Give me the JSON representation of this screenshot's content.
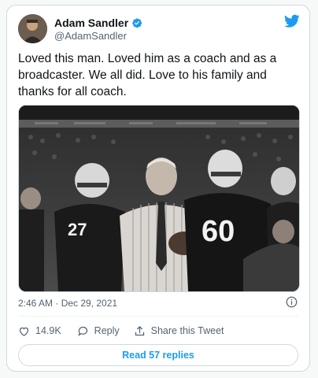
{
  "author": {
    "name": "Adam Sandler",
    "handle": "@AdamSandler",
    "verified": true
  },
  "tweet": {
    "text": "Loved this man. Loved him as a coach and as a broadcaster. We all did. Love to his family and thanks for all coach.",
    "timestamp": "2:46 AM · Dec 29, 2021"
  },
  "media": {
    "jersey_numbers": [
      "27",
      "60"
    ]
  },
  "actions": {
    "like_count": "14.9K",
    "reply_label": "Reply",
    "share_label": "Share this Tweet"
  },
  "read_replies_label": "Read 57 replies",
  "colors": {
    "accent": "#1d9bf0",
    "text_primary": "#0f1419",
    "text_secondary": "#536471",
    "border": "#cfd9de"
  },
  "icons": [
    "twitter-bird-icon",
    "verified-badge-icon",
    "info-icon",
    "heart-icon",
    "reply-icon",
    "share-icon"
  ]
}
